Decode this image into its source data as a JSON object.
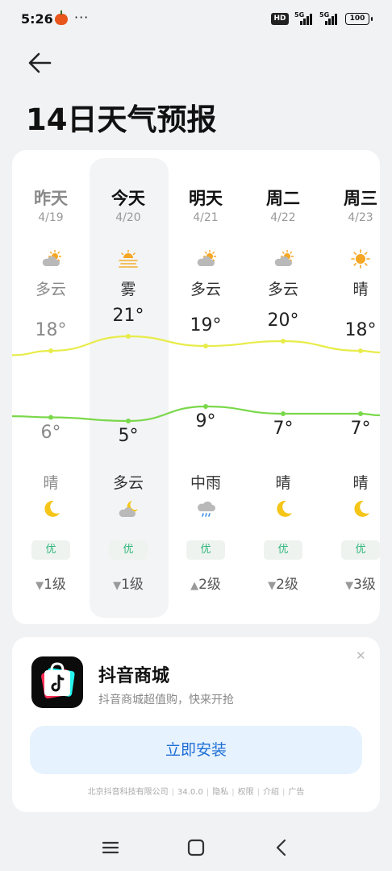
{
  "status_bar": {
    "time": "5:26",
    "dots": "···",
    "hd_label": "HD",
    "net1": "5G",
    "net2": "5G",
    "battery": "100"
  },
  "header": {
    "title": "14日天气预报",
    "back_icon": "arrow-left-icon"
  },
  "forecast": {
    "days": [
      {
        "name": "昨天",
        "date": "4/19",
        "day_condition": "多云",
        "day_icon": "partly-cloudy-icon",
        "high": "18°",
        "low": "6°",
        "night_condition": "晴",
        "night_icon": "moon-icon",
        "aqi": "优",
        "wind": "1级",
        "wind_dir": "▼",
        "past": true,
        "hi_c": 18,
        "lo_c": 6
      },
      {
        "name": "今天",
        "date": "4/20",
        "day_condition": "雾",
        "day_icon": "fog-sun-icon",
        "high": "21°",
        "low": "5°",
        "night_condition": "多云",
        "night_icon": "cloudy-moon-icon",
        "aqi": "优",
        "wind": "1级",
        "wind_dir": "▼",
        "past": false,
        "hi_c": 21,
        "lo_c": 5
      },
      {
        "name": "明天",
        "date": "4/21",
        "day_condition": "多云",
        "day_icon": "partly-cloudy-icon",
        "high": "19°",
        "low": "9°",
        "night_condition": "中雨",
        "night_icon": "rain-icon",
        "aqi": "优",
        "wind": "2级",
        "wind_dir": "▲",
        "past": false,
        "hi_c": 19,
        "lo_c": 9
      },
      {
        "name": "周二",
        "date": "4/22",
        "day_condition": "多云",
        "day_icon": "partly-cloudy-icon",
        "high": "20°",
        "low": "7°",
        "night_condition": "晴",
        "night_icon": "moon-icon",
        "aqi": "优",
        "wind": "2级",
        "wind_dir": "▼",
        "past": false,
        "hi_c": 20,
        "lo_c": 7
      },
      {
        "name": "周三",
        "date": "4/23",
        "day_condition": "晴",
        "day_icon": "sun-icon",
        "high": "18°",
        "low": "7°",
        "night_condition": "晴",
        "night_icon": "moon-icon",
        "aqi": "优",
        "wind": "3级",
        "wind_dir": "▼",
        "past": false,
        "hi_c": 18,
        "lo_c": 7
      }
    ],
    "colors": {
      "high_line": "#e8ec4a",
      "low_line": "#7ad84a",
      "aqi_text": "#2fb67a",
      "moon": "#f5c518",
      "sun": "#f5a623"
    }
  },
  "ad": {
    "app_name": "抖音商城",
    "description": "抖音商城超值购，快来开抢",
    "install_button": "立即安装",
    "footer": [
      "北京抖音科技有限公司",
      "34.0.0",
      "隐私",
      "权限",
      "介绍",
      "广告"
    ],
    "close_icon": "close-icon"
  },
  "nav_bar": {
    "menu_icon": "menu-icon",
    "home_icon": "home-icon",
    "back_icon": "back-chevron-icon"
  }
}
